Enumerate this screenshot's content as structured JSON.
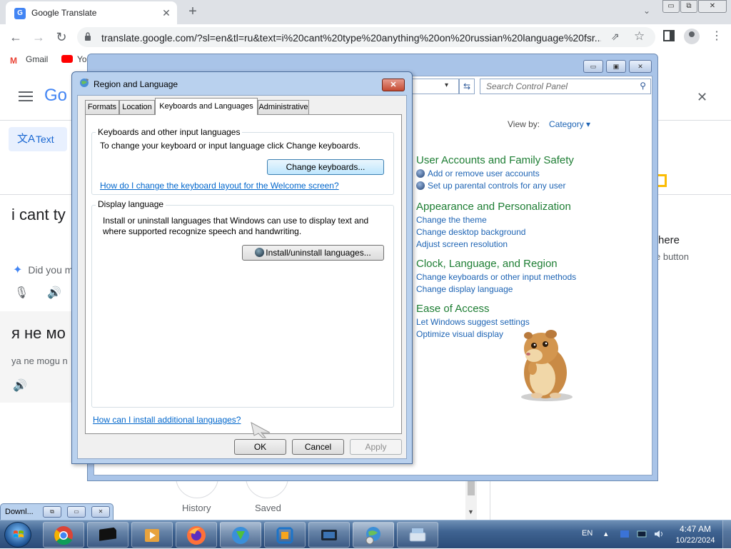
{
  "browser": {
    "tab_title": "Google Translate",
    "tab_favicon": "G",
    "tab_close": "✕",
    "new_tab": "+",
    "tab_search": "⌄",
    "window_controls": {
      "minimize": "▭",
      "restore": "⧉",
      "close": "✕"
    },
    "nav": {
      "back": "←",
      "forward": "→",
      "reload": "↻"
    },
    "url": "translate.google.com/?sl=en&tl=ru&text=i%20cant%20type%20anything%20on%20russian%20language%20fsr...",
    "share": "⇗",
    "star": "☆",
    "menu": "⋮",
    "bookmarks": [
      {
        "label": "Gmail",
        "icon": "M"
      },
      {
        "label": "Yo",
        "icon": "youtube"
      }
    ]
  },
  "translate": {
    "logo": "Go",
    "text_tab": "Text",
    "text_tab_icon": "文A",
    "source_text": "i cant ty",
    "did_you_mean": "Did you m",
    "sparkle": "✦",
    "mic": "🎙",
    "speaker": "🔊",
    "target_text": "я не мо",
    "transliteration": "ya ne mogu n",
    "right_close": "✕",
    "right_text1": "here",
    "right_text2": "e button",
    "history_label": "History",
    "saved_label": "Saved",
    "scroll_down": "▼"
  },
  "control_panel": {
    "window_controls": {
      "minimize": "▭",
      "restore": "▣",
      "close": "✕"
    },
    "address_dropdown": "▾",
    "refresh": "⇆",
    "search_placeholder": "Search Control Panel",
    "search_icon": "⚲",
    "view_by_label": "View by:",
    "view_by_value": "Category ▾",
    "sections": [
      {
        "heading": "User Accounts and Family Safety",
        "links": [
          "Add or remove user accounts",
          "Set up parental controls for any user"
        ]
      },
      {
        "heading": "Appearance and Personalization",
        "links": [
          "Change the theme",
          "Change desktop background",
          "Adjust screen resolution"
        ]
      },
      {
        "heading": "Clock, Language, and Region",
        "links": [
          "Change keyboards or other input methods",
          "Change display language"
        ]
      },
      {
        "heading": "Ease of Access",
        "links": [
          "Let Windows suggest settings",
          "Optimize visual display"
        ]
      }
    ]
  },
  "region_dialog": {
    "title": "Region and Language",
    "close": "✕",
    "tabs": [
      "Formats",
      "Location",
      "Keyboards and Languages",
      "Administrative"
    ],
    "active_tab": "Keyboards and Languages",
    "keyboards_group_title": "Keyboards and other input languages",
    "keyboards_desc": "To change your keyboard or input language click Change keyboards.",
    "change_keyboards_btn": "Change keyboards...",
    "welcome_link": "How do I change the keyboard layout for the Welcome screen?",
    "display_group_title": "Display language",
    "display_desc": "Install or uninstall languages that Windows can use to display text and where supported recognize speech and handwriting.",
    "install_btn": "Install/uninstall languages...",
    "additional_link": "How can I install additional languages?",
    "ok_btn": "OK",
    "cancel_btn": "Cancel",
    "apply_btn": "Apply"
  },
  "download_window": {
    "title": "Downl...",
    "controls": {
      "restore": "⧉",
      "maximize": "▭",
      "close": "✕"
    }
  },
  "taskbar": {
    "language": "EN",
    "tray_arrow": "▴",
    "time": "4:47 AM",
    "date": "10/22/2024",
    "apps": [
      "chrome",
      "terminal",
      "media-player",
      "firefox",
      "internet-download-manager",
      "virtualbox",
      "monitor-app",
      "control-panel-globe",
      "keyboard-app"
    ]
  }
}
